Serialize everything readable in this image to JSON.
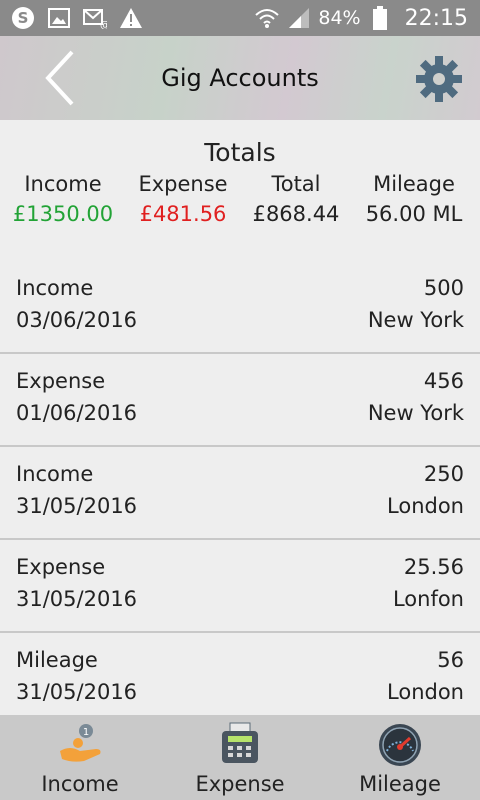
{
  "status_bar": {
    "battery": "84%",
    "time": "22:15",
    "icons": [
      "skype-icon",
      "gallery-icon",
      "email-icon",
      "warning-icon",
      "wifi-icon",
      "signal-icon",
      "battery-icon"
    ]
  },
  "header": {
    "title": "Gig Accounts",
    "back_icon": "chevron-left-icon",
    "settings_icon": "gear-icon"
  },
  "totals": {
    "heading": "Totals",
    "income_label": "Income",
    "income_value": "£1350.00",
    "expense_label": "Expense",
    "expense_value": "£481.56",
    "total_label": "Total",
    "total_value": "£868.44",
    "mileage_label": "Mileage",
    "mileage_value": "56.00 ML",
    "colors": {
      "income": "#22a336",
      "expense": "#e02020"
    }
  },
  "entries": [
    {
      "type": "Income",
      "date": "03/06/2016",
      "amount": "500",
      "location": "New York"
    },
    {
      "type": "Expense",
      "date": "01/06/2016",
      "amount": "456",
      "location": "New York"
    },
    {
      "type": "Income",
      "date": "31/05/2016",
      "amount": "250",
      "location": "London"
    },
    {
      "type": "Expense",
      "date": "31/05/2016",
      "amount": "25.56",
      "location": "Lonfon"
    },
    {
      "type": "Mileage",
      "date": "31/05/2016",
      "amount": "56",
      "location": "London"
    }
  ],
  "bottom_nav": [
    {
      "label": "Income",
      "icon": "income-hand-coins-icon"
    },
    {
      "label": "Expense",
      "icon": "expense-receipt-icon"
    },
    {
      "label": "Mileage",
      "icon": "speedometer-icon"
    }
  ]
}
